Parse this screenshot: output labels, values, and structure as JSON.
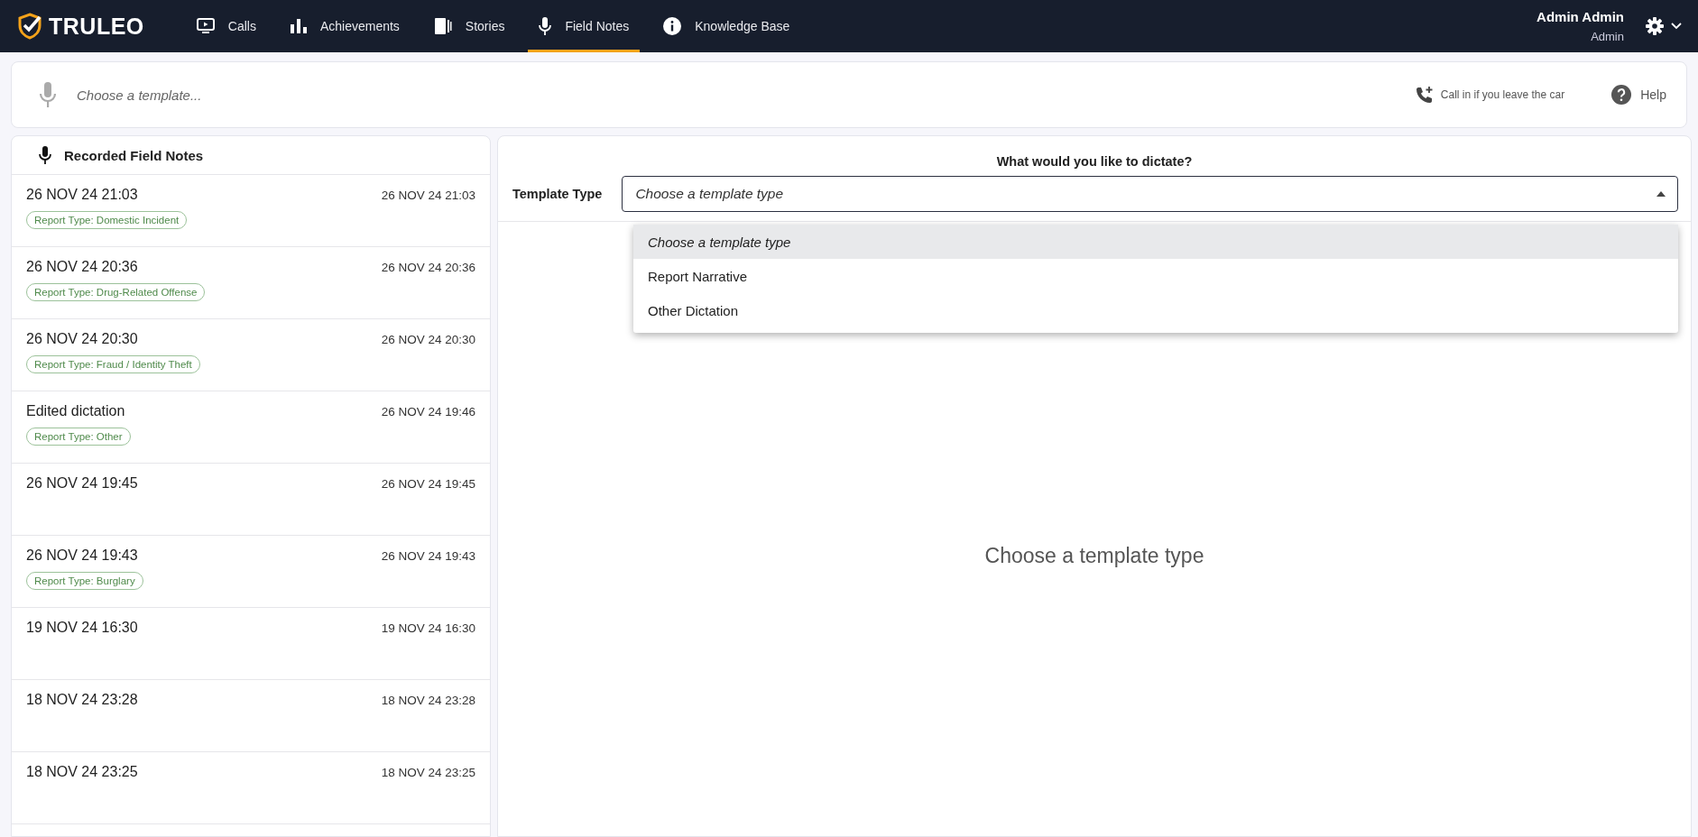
{
  "nav": {
    "logo": "TRULEO",
    "items": [
      {
        "label": "Calls",
        "selected": false
      },
      {
        "label": "Achievements",
        "selected": false
      },
      {
        "label": "Stories",
        "selected": false
      },
      {
        "label": "Field Notes",
        "selected": true
      },
      {
        "label": "Knowledge Base",
        "selected": false
      }
    ],
    "user": {
      "name": "Admin Admin",
      "role": "Admin"
    }
  },
  "template_bar": {
    "placeholder": "Choose a template...",
    "call_in": "Call in if you leave the car",
    "help": "Help"
  },
  "field_notes": {
    "title": "Recorded Field Notes",
    "items": [
      {
        "title": "26 NOV 24 21:03",
        "time": "26 NOV 24 21:03",
        "tag": "Report Type: Domestic Incident"
      },
      {
        "title": "26 NOV 24 20:36",
        "time": "26 NOV 24 20:36",
        "tag": "Report Type: Drug-Related Offense"
      },
      {
        "title": "26 NOV 24 20:30",
        "time": "26 NOV 24 20:30",
        "tag": "Report Type: Fraud / Identity Theft"
      },
      {
        "title": "Edited dictation",
        "time": "26 NOV 24 19:46",
        "tag": "Report Type: Other"
      },
      {
        "title": "26 NOV 24 19:45",
        "time": "26 NOV 24 19:45"
      },
      {
        "title": "26 NOV 24 19:43",
        "time": "26 NOV 24 19:43",
        "tag": "Report Type: Burglary"
      },
      {
        "title": "19 NOV 24 16:30",
        "time": "19 NOV 24 16:30"
      },
      {
        "title": "18 NOV 24 23:28",
        "time": "18 NOV 24 23:28"
      },
      {
        "title": "18 NOV 24 23:25",
        "time": "18 NOV 24 23:25"
      }
    ]
  },
  "dictate": {
    "heading": "What would you like to dictate?",
    "label": "Template Type",
    "placeholder": "Choose a template type",
    "expanded": true,
    "options": [
      {
        "label": "Choose a template type",
        "selected": true
      },
      {
        "label": "Report Narrative",
        "selected": false
      },
      {
        "label": "Other Dictation",
        "selected": false
      }
    ],
    "empty_message": "Choose a template type"
  }
}
